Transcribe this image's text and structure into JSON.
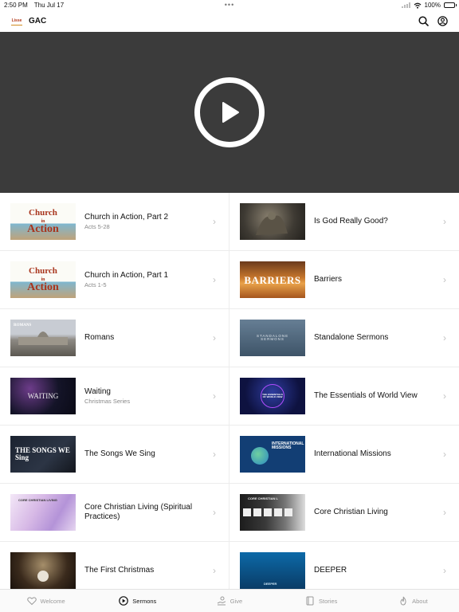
{
  "status_bar": {
    "time": "2:50 PM",
    "date": "Thu Jul 17",
    "battery": "100%"
  },
  "header": {
    "title": "GAC",
    "logo_text": "Lisse"
  },
  "player": {
    "state": "paused"
  },
  "sermons": [
    {
      "title": "Church in Action, Part 2",
      "subtitle": "Acts 5-28",
      "thumb": "church-in-action-art"
    },
    {
      "title": "Is God Really Good?",
      "subtitle": "",
      "thumb": "is-god-good-art"
    },
    {
      "title": "Church in Action, Part 1",
      "subtitle": "Acts 1-5",
      "thumb": "church-in-action-art"
    },
    {
      "title": "Barriers",
      "subtitle": "",
      "thumb": "barriers-art",
      "thumb_text": "BARRIERS"
    },
    {
      "title": "Romans",
      "subtitle": "",
      "thumb": "romans-art",
      "thumb_text": "ROMANS"
    },
    {
      "title": "Standalone Sermons",
      "subtitle": "",
      "thumb": "standalone-art",
      "thumb_text": "STANDALONE SERMONS"
    },
    {
      "title": "Waiting",
      "subtitle": "Christmas Series",
      "thumb": "waiting-art",
      "thumb_text": "WAITING"
    },
    {
      "title": "The Essentials of World View",
      "subtitle": "",
      "thumb": "world-view-art",
      "thumb_text": "THE ESSENTIALS OF WORLD VIEW"
    },
    {
      "title": "The Songs We Sing",
      "subtitle": "",
      "thumb": "songs-art",
      "thumb_text": "THE SONGS WE Sing"
    },
    {
      "title": "International Missions",
      "subtitle": "",
      "thumb": "missions-art",
      "thumb_text": "INTERNATIONAL MISSIONS"
    },
    {
      "title": "Core Christian Living (Spiritual Practices)",
      "subtitle": "",
      "thumb": "core-living-art",
      "thumb_text": "CORE CHRISTIAN LIVING"
    },
    {
      "title": "Core Christian Living",
      "subtitle": "",
      "thumb": "core-living-dark-art",
      "thumb_text": "CORE CHRISTIAN L"
    },
    {
      "title": "The First Christmas",
      "subtitle": "",
      "thumb": "first-christmas-art"
    },
    {
      "title": "DEEPER",
      "subtitle": "",
      "thumb": "deeper-art",
      "thumb_text": "DEEPER"
    }
  ],
  "thumb_caption": {
    "church": "Church",
    "in": "in",
    "action": "Action"
  },
  "tabs": [
    {
      "label": "Welcome",
      "icon": "heart-icon",
      "active": false
    },
    {
      "label": "Sermons",
      "icon": "play-circle-icon",
      "active": true
    },
    {
      "label": "Give",
      "icon": "give-icon",
      "active": false
    },
    {
      "label": "Stories",
      "icon": "book-icon",
      "active": false
    },
    {
      "label": "About",
      "icon": "flame-icon",
      "active": false
    }
  ]
}
